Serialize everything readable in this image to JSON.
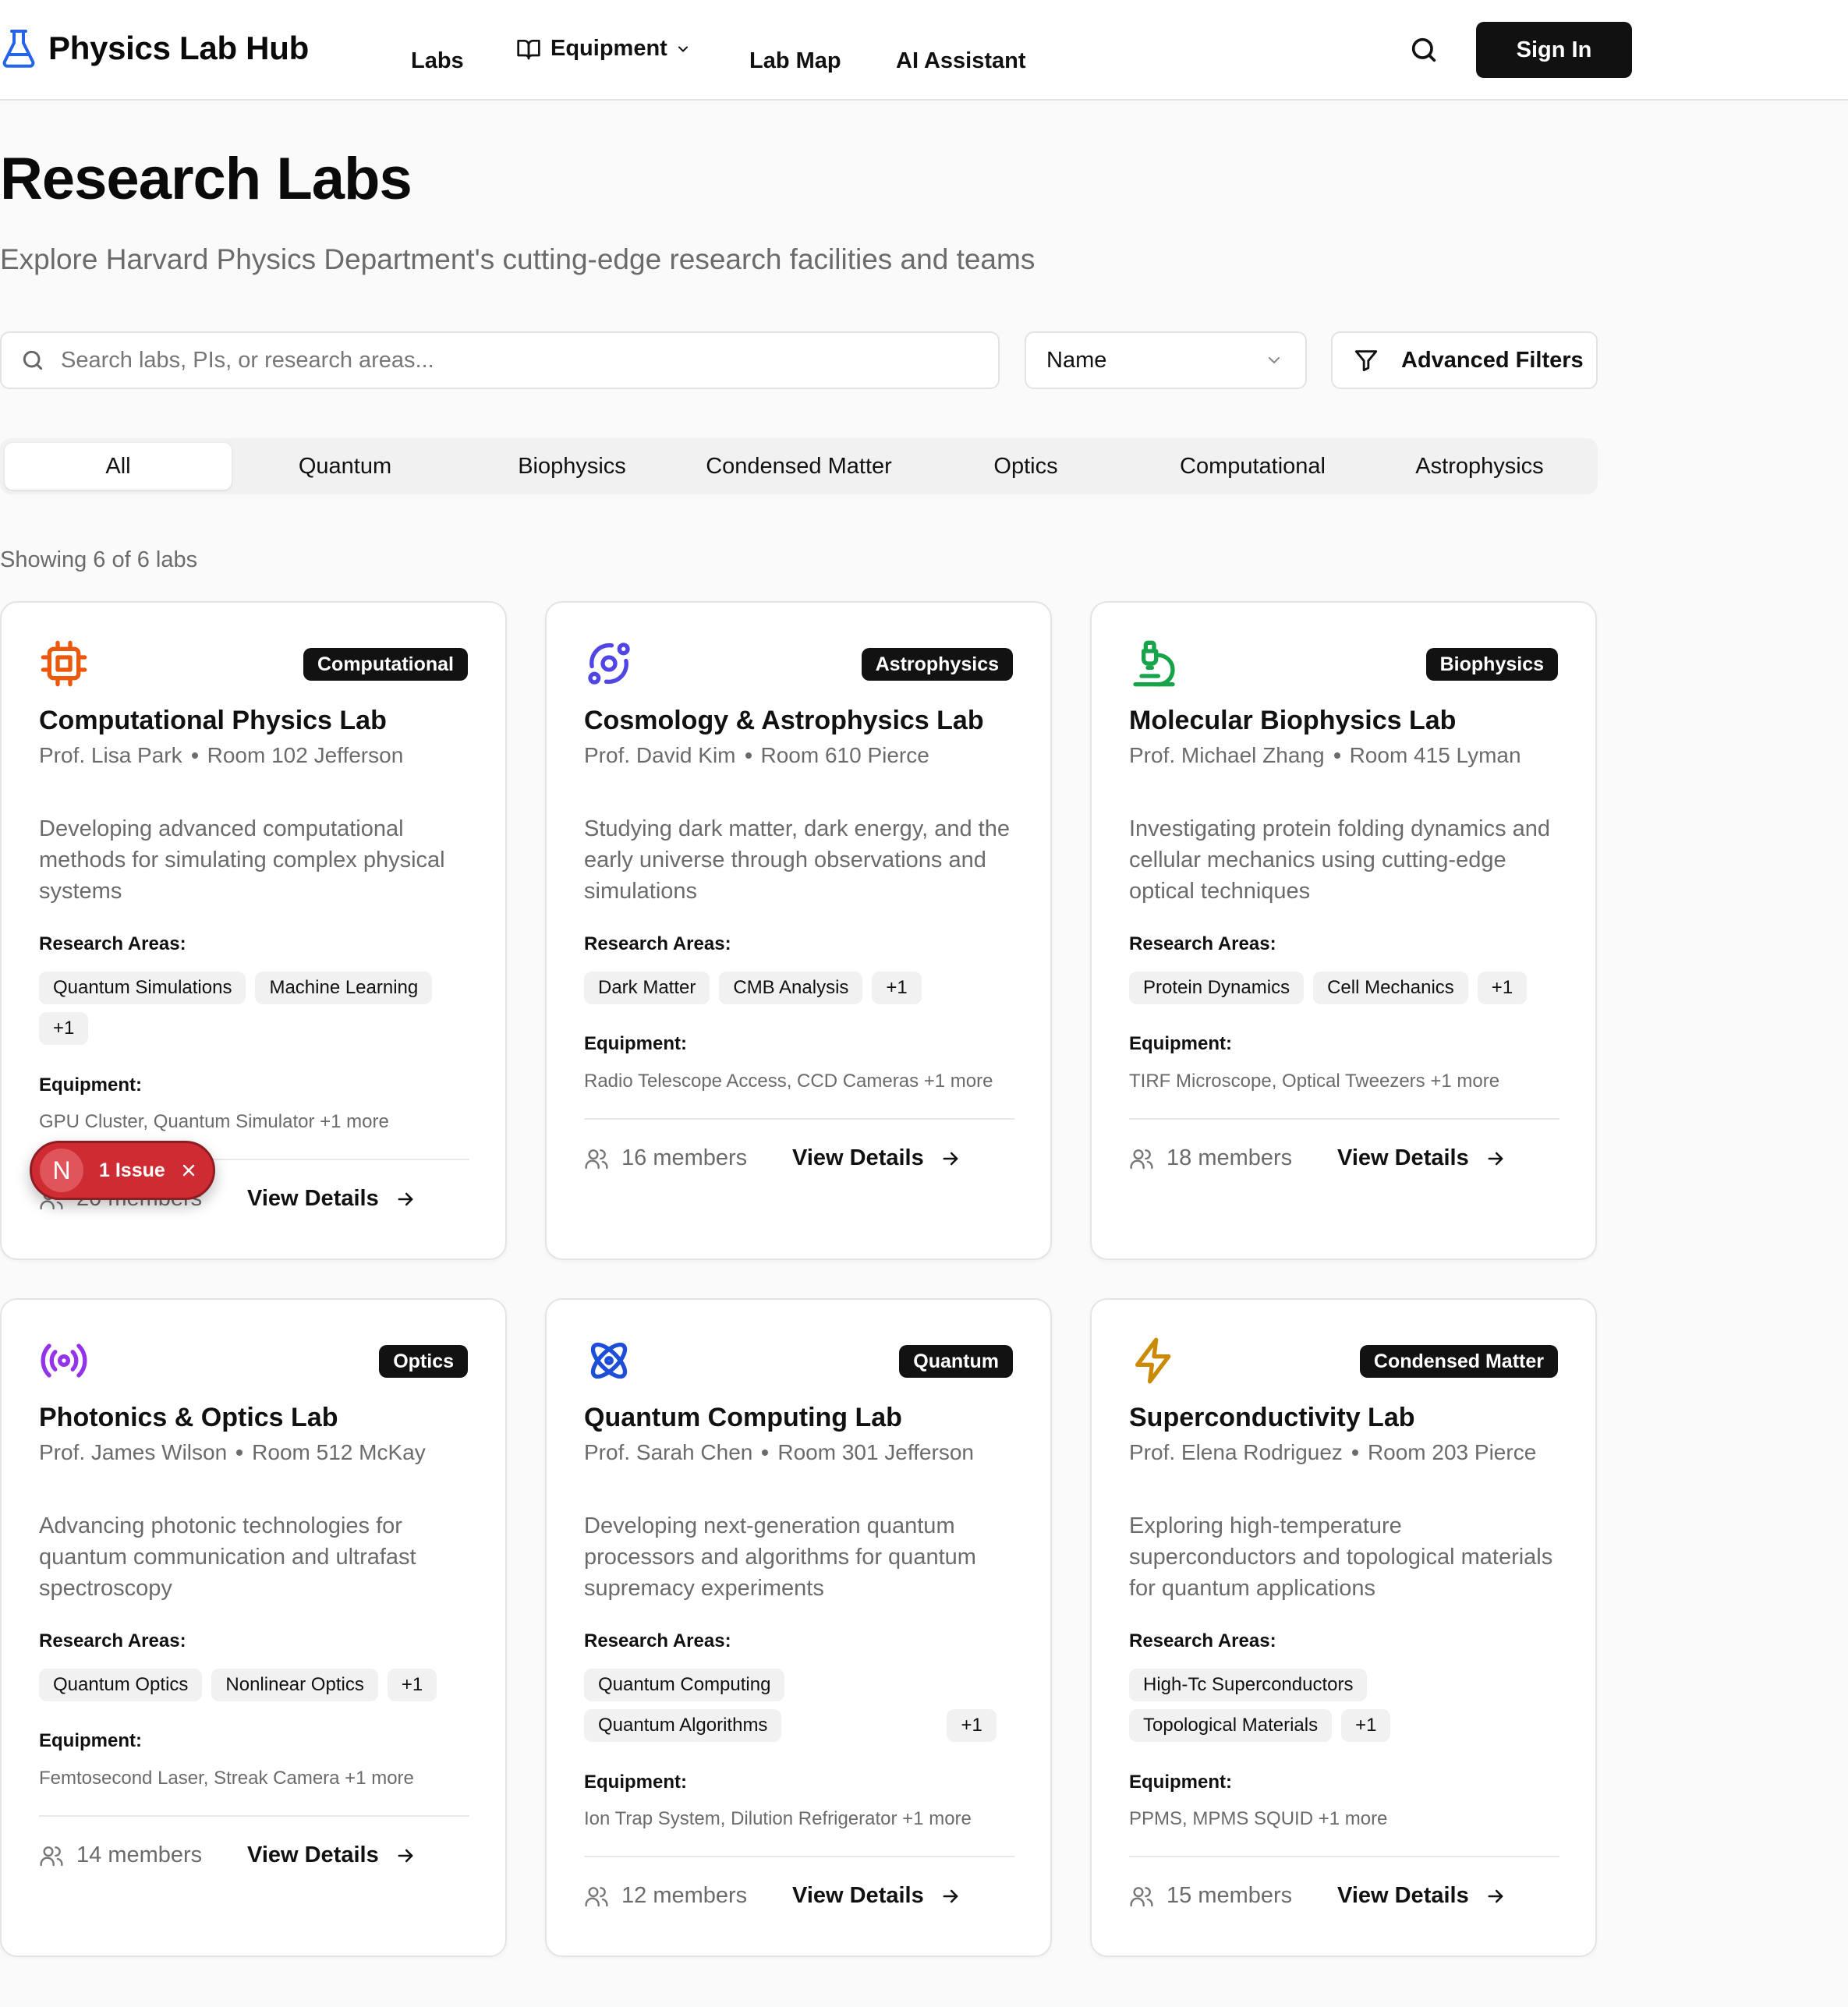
{
  "header": {
    "brand": "Physics Lab Hub",
    "nav": {
      "labs": "Labs",
      "equipment": "Equipment",
      "lab_map": "Lab Map",
      "ai_assistant": "AI Assistant"
    },
    "sign_in": "Sign In"
  },
  "page": {
    "title": "Research Labs",
    "subtitle": "Explore Harvard Physics Department's cutting-edge research facilities and teams"
  },
  "toolbar": {
    "search_placeholder": "Search labs, PIs, or research areas...",
    "search_value": "",
    "sort_value": "Name",
    "advanced_filters": "Advanced Filters"
  },
  "tabs": [
    "All",
    "Quantum",
    "Biophysics",
    "Condensed Matter",
    "Optics",
    "Computational",
    "Astrophysics"
  ],
  "active_tab": "All",
  "showing_text": "Showing 6 of 6 labs",
  "labels": {
    "research_areas": "Research Areas:",
    "equipment": "Equipment:",
    "view_details": "View Details"
  },
  "labs": [
    {
      "icon": "cpu-icon",
      "icon_color": "#ea580c",
      "badge": "Computational",
      "name": "Computational Physics Lab",
      "pi": "Prof. Lisa Park",
      "room": "Room 102 Jefferson",
      "description": "Developing advanced computational methods for simulating complex physical systems",
      "areas": [
        "Quantum Simulations",
        "Machine Learning",
        "+1"
      ],
      "equipment": "GPU Cluster, Quantum Simulator +1 more",
      "members": "20 members"
    },
    {
      "icon": "orbit-icon",
      "icon_color": "#4f46e5",
      "badge": "Astrophysics",
      "name": "Cosmology & Astrophysics Lab",
      "pi": "Prof. David Kim",
      "room": "Room 610 Pierce",
      "description": "Studying dark matter, dark energy, and the early universe through observations and simulations",
      "areas": [
        "Dark Matter",
        "CMB Analysis",
        "+1"
      ],
      "equipment": "Radio Telescope Access, CCD Cameras +1 more",
      "members": "16 members"
    },
    {
      "icon": "microscope-icon",
      "icon_color": "#16a34a",
      "badge": "Biophysics",
      "name": "Molecular Biophysics Lab",
      "pi": "Prof. Michael Zhang",
      "room": "Room 415 Lyman",
      "description": "Investigating protein folding dynamics and cellular mechanics using cutting-edge optical techniques",
      "areas": [
        "Protein Dynamics",
        "Cell Mechanics",
        "+1"
      ],
      "equipment": "TIRF Microscope, Optical Tweezers +1 more",
      "members": "18 members"
    },
    {
      "icon": "radio-icon",
      "icon_color": "#9333ea",
      "badge": "Optics",
      "name": "Photonics & Optics Lab",
      "pi": "Prof. James Wilson",
      "room": "Room 512 McKay",
      "description": "Advancing photonic technologies for quantum communication and ultrafast spectroscopy",
      "areas": [
        "Quantum Optics",
        "Nonlinear Optics",
        "+1"
      ],
      "equipment": "Femtosecond Laser, Streak Camera +1 more",
      "members": "14 members"
    },
    {
      "icon": "atom-icon",
      "icon_color": "#1d4ed8",
      "badge": "Quantum",
      "name": "Quantum Computing Lab",
      "pi": "Prof. Sarah Chen",
      "room": "Room 301 Jefferson",
      "description": "Developing next-generation quantum processors and algorithms for quantum supremacy experiments",
      "areas": [
        "Quantum Computing",
        "Quantum Algorithms",
        "+1"
      ],
      "equipment": "Ion Trap System, Dilution Refrigerator +1 more",
      "members": "12 members"
    },
    {
      "icon": "zap-icon",
      "icon_color": "#ca8a04",
      "badge": "Condensed Matter",
      "name": "Superconductivity Lab",
      "pi": "Prof. Elena Rodriguez",
      "room": "Room 203 Pierce",
      "description": "Exploring high-temperature superconductors and topological materials for quantum applications",
      "areas": [
        "High-Tc Superconductors",
        "Topological Materials",
        "+1"
      ],
      "equipment": "PPMS, MPMS SQUID +1 more",
      "members": "15 members"
    }
  ],
  "issue_pill": {
    "initial": "N",
    "text": "1 Issue"
  }
}
